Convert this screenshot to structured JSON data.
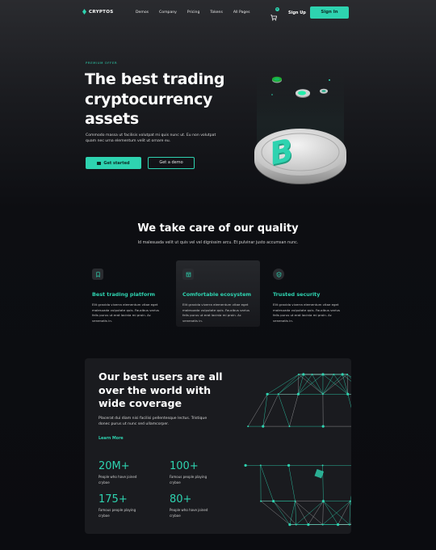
{
  "nav": {
    "brand": "CRYPTOS",
    "links": [
      "Demos",
      "Company",
      "Pricing",
      "Tokens",
      "All Pages"
    ],
    "cart_count": "0",
    "signup": "Sign Up",
    "signin": "Sign In"
  },
  "hero": {
    "eyebrow": "PREMIUM OFFER",
    "title": "The best trading cryptocurrency assets",
    "description": "Commodo massa ut facilisis volutpat mi quis nunc ut. Eu non volutpat quam nec urna elementum velit ut ornare eu.",
    "primary_button": "Get started",
    "secondary_button": "Get a demo"
  },
  "quality": {
    "title": "We take care of our quality",
    "subtitle": "Id malesuada velit ut quis vel vel dignissim arcu. Et pulvinar justo accumsan nunc.",
    "features": [
      {
        "title": "Best trading platform",
        "icon": "bookmark-icon",
        "description": "Elit gravida viverra elementum vitae eget malesuada vulputate quis. Faucibus varius felis purus ut erat lacinia mi proin. Ac venenatis in."
      },
      {
        "title": "Comfortable ecosystem",
        "icon": "layout-icon",
        "description": "Elit gravida viverra elementum vitae eget malesuada vulputate quis. Faucibus varius felis purus ut erat lacinia mi proin. Ac venenatis in."
      },
      {
        "title": "Trusted security",
        "icon": "shield-icon",
        "description": "Elit gravida viverra elementum vitae eget malesuada vulputate quis. Faucibus varius felis purus ut erat lacinia mi proin. Ac venenatis in."
      }
    ]
  },
  "users": {
    "title": "Our best users are all over the world with wide coverage",
    "description": "Placerat dui diam nisi facilisi pellentesque lectus. Tristique donec purus ut nunc sed ullamcorper.",
    "link": "Learn More",
    "stats": [
      {
        "value": "20M+",
        "label": "People who have joined cryboe"
      },
      {
        "value": "100+",
        "label": "Famous people playing cryboe"
      },
      {
        "value": "175+",
        "label": "Famous people playing cryboe"
      },
      {
        "value": "80+",
        "label": "People who have joined cryboe"
      }
    ]
  },
  "colors": {
    "accent": "#2ed3b0",
    "background": "#0b0c10",
    "card": "#1a1b1f"
  }
}
